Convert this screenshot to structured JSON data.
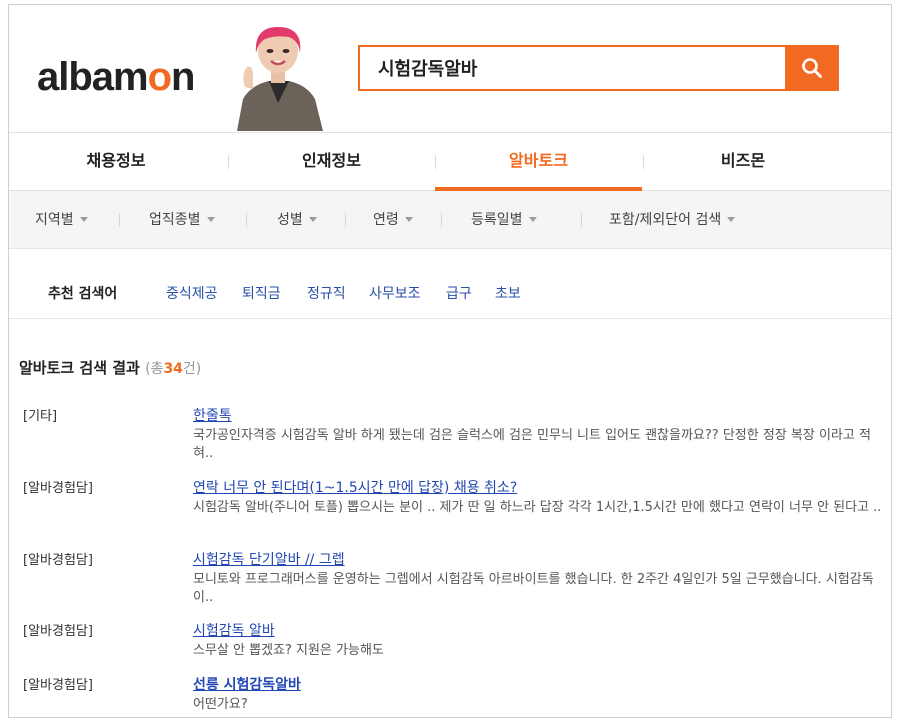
{
  "header": {
    "logo_prefix": "albam",
    "logo_accent": "o",
    "logo_suffix": "n",
    "search_value": "시험감독알바",
    "search_icon": "search-icon"
  },
  "colors": {
    "accent": "#f26a21",
    "link": "#2247b3"
  },
  "main_nav": {
    "tabs": [
      {
        "label": "채용정보"
      },
      {
        "label": "인재정보"
      },
      {
        "label": "알바토크"
      },
      {
        "label": "비즈몬"
      }
    ],
    "active_index": 2
  },
  "filters": [
    "지역별",
    "업직종별",
    "성별",
    "연령",
    "등록일별",
    "포함/제외단어 검색"
  ],
  "recommended": {
    "label": "추천 검색어",
    "keywords": [
      "중식제공",
      "퇴직금",
      "정규직",
      "사무보조",
      "급구",
      "초보"
    ]
  },
  "results": {
    "title": "알바토크 검색 결과",
    "paren_open": "(총",
    "count": "34",
    "paren_close": "건)",
    "items": [
      {
        "category": "[기타]",
        "title": "한줄톡",
        "snippet": "국가공인자격증 시험감독 알바 하게 됐는데 검은 슬럭스에 검은 민무늬 니트 입어도 괜찮을까요?? 단정한 정장 복장 이라고 적혀..",
        "bold": false
      },
      {
        "category": "[알바경험담]",
        "title": "연락 너무 안 된다며(1~1.5시간 만에 답장) 채용 취소?",
        "snippet": "시험감독 알바(주니어 토플) 뽑으시는 분이 .. 제가 딴 일 하느라 답장 각각 1시간,1.5시간 만에 했다고 연락이 너무 안 된다고 ..",
        "bold": false
      },
      {
        "category": "[알바경험담]",
        "title": "시험감독 단기알바 // 그렙",
        "snippet": "모니토와 프로그래머스를 운영하는 그렙에서 시험감독 아르바이트를 했습니다. 한 2주간 4일인가 5일 근무했습니다. 시험감독이..",
        "bold": false
      },
      {
        "category": "[알바경험담]",
        "title": "시험감독 알바",
        "snippet": "스무살 안 뽑겠죠? 지원은 가능해도",
        "bold": false
      },
      {
        "category": "[알바경험담]",
        "title": "선릉 시험감독알바",
        "snippet": "어떤가요?",
        "bold": true
      }
    ]
  }
}
